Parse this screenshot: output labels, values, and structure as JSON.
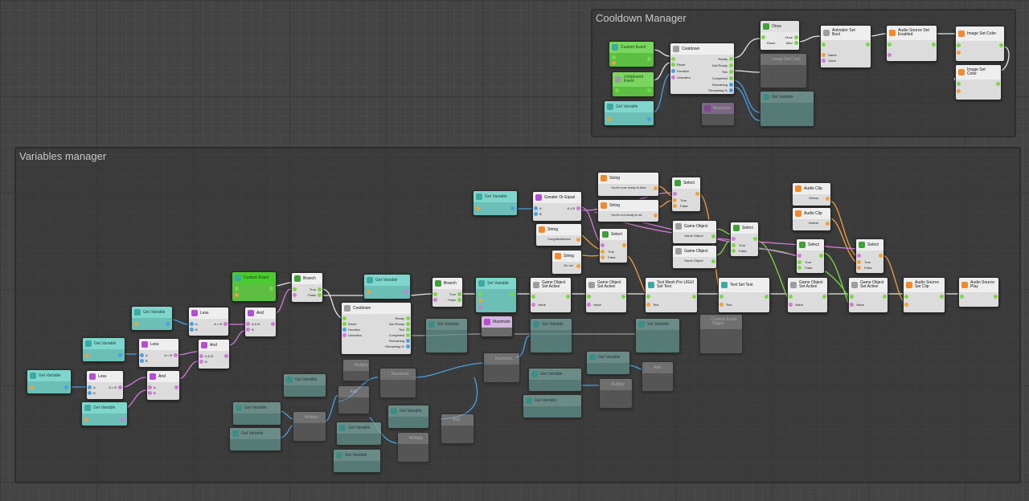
{
  "groups": {
    "cooldown_manager": "Cooldown Manager",
    "variables_manager": "Variables manager"
  },
  "nodes": {
    "custom_event": "Custom Event",
    "unity_event": "UnityEvent Event",
    "get_variable": "Get Variable",
    "cooldown": "Cooldown",
    "once": "Once",
    "animator_set_bool": "Animator Set Bool",
    "audio_source_set_enabled": "Audio Source Set Enabled",
    "image_set_color": "Image Set Color",
    "image_set_color_2": "Image Set Color",
    "less": "Less",
    "and": "And",
    "branch": "Branch",
    "set_variable": "Set Variable",
    "greater_or_equal": "Greater Or Equal",
    "string_ready": "String",
    "string_ready_value": "You're now ready to face",
    "string_not_ready": "String",
    "string_not_ready_value": "You're not ready to se",
    "string_congrats": "String",
    "string_congrats_value": "Congratulations!",
    "string_oh_no": "String",
    "string_oh_no_value": "Oh no!",
    "select": "Select",
    "game_object": "Game Object",
    "game_object_value": "Game Object",
    "game_object_set_active": "Game Object Set Active",
    "tmp_set_text": "Text Mesh Pro UGUI Set Text",
    "text_set_text": "Text Set Text",
    "audio_clip_victory": "Audio Clip",
    "audio_clip_victory_value": "Victory",
    "audio_clip_defeat": "Audio Clip",
    "audio_clip_defeat_value": "Defeat",
    "audio_source_set_clip": "Audio Source Set Clip",
    "audio_source_play": "Audio Source Play",
    "multiply": "Multiply",
    "add": "Add",
    "maximum": "Maximum",
    "custom_event_trigger": "Custom Event Trigger"
  },
  "ports": {
    "ready": "Ready",
    "not_ready": "Not Ready",
    "tick": "Tick",
    "completed": "Completed",
    "remaining": "Remaining",
    "remaining_pct": "Remaining %",
    "reset": "Reset",
    "duration": "Duration",
    "unscaled": "Unscaled",
    "once": "Once",
    "after": "After",
    "name": "Name",
    "value": "Value",
    "true": "True",
    "false": "False",
    "a": "A",
    "b": "B",
    "a_lt_b": "A < B",
    "a_and_b": "A & B",
    "a_gte_b": "A ≥ B",
    "text": "Text"
  }
}
